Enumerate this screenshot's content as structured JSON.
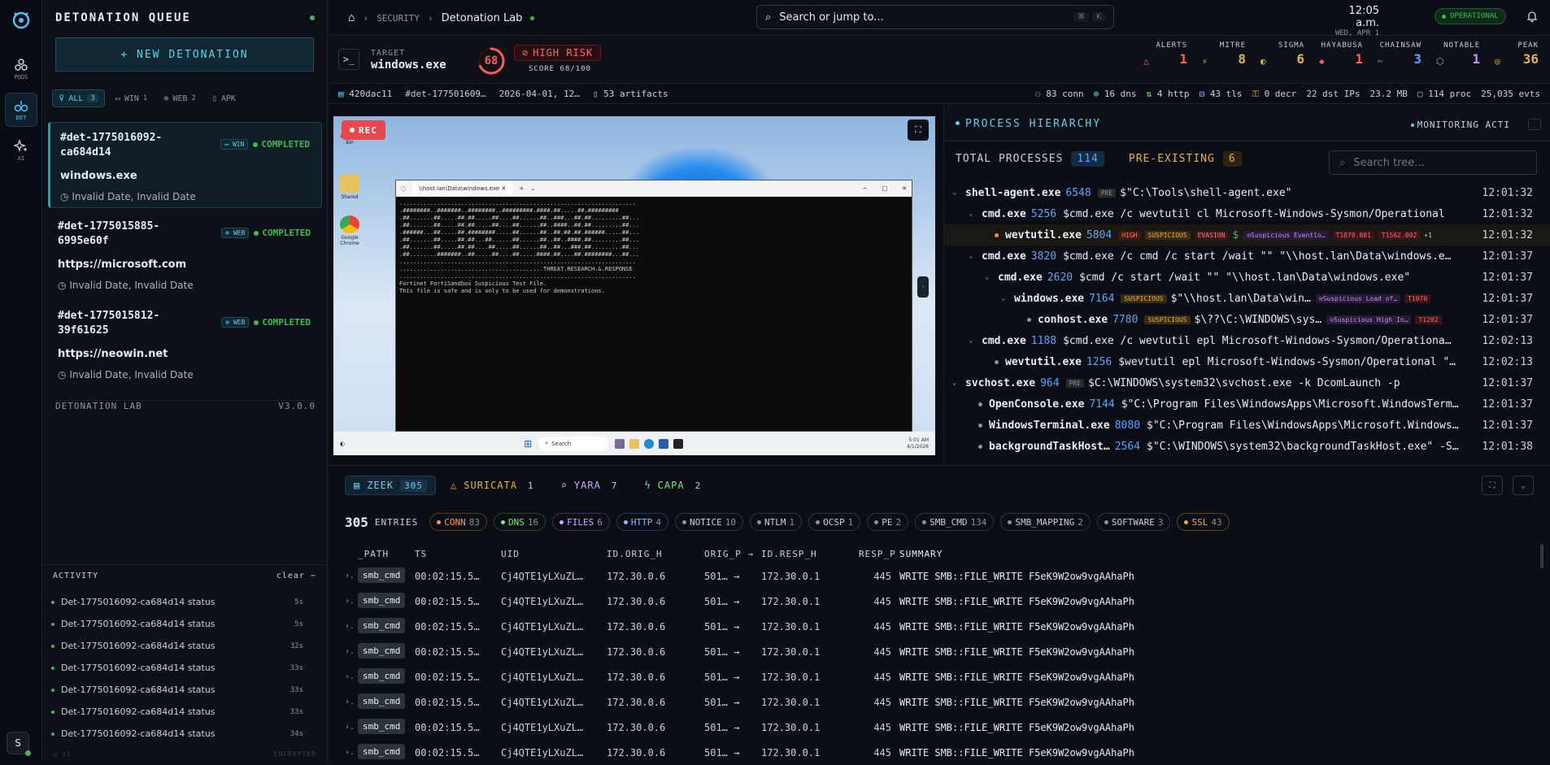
{
  "rail": {
    "items": [
      {
        "label": "PODS",
        "icon": "pods-icon"
      },
      {
        "label": "DET",
        "icon": "detonation-icon"
      },
      {
        "label": "AI",
        "icon": "ai-icon"
      }
    ],
    "avatar": "S"
  },
  "queue": {
    "title": "DETONATION QUEUE",
    "new_button": "+ NEW DETONATION",
    "filters": [
      {
        "label": "ALL",
        "count": "3"
      },
      {
        "label": "WIN",
        "count": "1"
      },
      {
        "label": "WEB",
        "count": "2"
      },
      {
        "label": "APK",
        "count": ""
      }
    ],
    "items": [
      {
        "id": "#det-1775016092-ca684d14",
        "os": "WIN",
        "status": "COMPLETED",
        "name": "windows.exe",
        "date": "Invalid Date, Invalid Date"
      },
      {
        "id": "#det-1775015885-6995e60f",
        "os": "WEB",
        "status": "COMPLETED",
        "name": "https://microsoft.com",
        "date": "Invalid Date, Invalid Date"
      },
      {
        "id": "#det-1775015812-39f61625",
        "os": "WEB",
        "status": "COMPLETED",
        "name": "https://neowin.net",
        "date": "Invalid Date, Invalid Date"
      }
    ],
    "footer_name": "DETONATION LAB",
    "footer_version": "V3.0.0",
    "activity": {
      "title": "ACTIVITY",
      "clear": "clear",
      "rows": [
        {
          "label": "Det-1775016092-ca684d14 status",
          "t": "5s"
        },
        {
          "label": "Det-1775016092-ca684d14 status",
          "t": "5s"
        },
        {
          "label": "Det-1775016092-ca684d14 status",
          "t": "32s"
        },
        {
          "label": "Det-1775016092-ca684d14 status",
          "t": "33s"
        },
        {
          "label": "Det-1775016092-ca684d14 status",
          "t": "33s"
        },
        {
          "label": "Det-1775016092-ca684d14 status",
          "t": "33s"
        },
        {
          "label": "Det-1775016092-ca684d14 status",
          "t": "34s"
        }
      ],
      "encrypted": "ENCRYPTED"
    }
  },
  "header": {
    "crumb1": "SECURITY",
    "crumb2": "Detonation Lab",
    "search_placeholder": "Search or jump to...",
    "kbd1": "⌘",
    "kbd2": "K",
    "time": "12:05 a.m.",
    "date": "WED, APR 1",
    "status": "OPERATIONAL"
  },
  "target": {
    "label": "TARGET",
    "name": "windows.exe",
    "score_num": "68",
    "risk": "HIGH RISK",
    "score": "SCORE 68/100",
    "score_fraction": 0.68,
    "stats": [
      {
        "label": "ALERTS",
        "value": "1",
        "color": "#ff5a5a",
        "icon": "△"
      },
      {
        "label": "MITRE",
        "value": "8",
        "color": "#e3b341",
        "icon": "⚡"
      },
      {
        "label": "SIGMA",
        "value": "6",
        "color": "#e3b341",
        "icon": "◐"
      },
      {
        "label": "HAYABUSA",
        "value": "1",
        "color": "#ff5a5a",
        "icon": "◆"
      },
      {
        "label": "CHAINSAW",
        "value": "3",
        "color": "#58a6ff",
        "icon": "✂"
      },
      {
        "label": "NOTABLE",
        "value": "1",
        "color": "#c792ea",
        "icon": "⬡"
      },
      {
        "label": "PEAK",
        "value": "36",
        "color": "#e3b341",
        "icon": "◎"
      }
    ]
  },
  "meta": {
    "hash": "420dac11",
    "det": "#det-177501609…",
    "date": "2026-04-01, 12…",
    "artifacts": "53 artifacts",
    "conn": "83 conn",
    "dns": "16 dns",
    "http": "4 http",
    "tls": "43 tls",
    "decr": "0 decr",
    "dst": "22 dst IPs",
    "size": "23.2 MB",
    "proc": "114 proc",
    "evts": "25,035 evts"
  },
  "video": {
    "rec": "REC",
    "term_title": "\\\\host.lan\\Data\\windows.exe",
    "term_lines": [
      ".....................................................................",
      ".########..#######..########..#########.####.##.....##.#########",
      ".##.......##.....##.##.....##....##......##..###...##.##.........##...",
      ".##.......##.....##.##.....##....##......##..####..##.##.........##...",
      ".######...##.....##.########.....##......##..##.##.##.######.....##...",
      ".##.......##.....##.##...##......##......##..##..####.##.........##...",
      ".##.......##.....##.##....##.....##......##..##...###.##.........##...",
      ".##........#######..##.....##....##.....####.##....##.########...##...",
      ".....................................................................",
      "..........................................THREAT.RESEARCH.&.RESPONSE",
      ".....................................................................",
      "Fortinet FortiSandbox Suspicious Test File.",
      "This file is safe and is only to be used for demonstrations."
    ],
    "desk_icons": [
      "Recycle Bin",
      "Shared",
      "Google Chrome"
    ],
    "taskbar_search": "Search",
    "tray_time": "5:01 AM",
    "tray_date": "4/1/2026"
  },
  "process": {
    "title": "PROCESS HIERARCHY",
    "monitoring": "MONITORING ACTI",
    "total_label": "TOTAL PROCESSES",
    "total": "114",
    "pre_label": "PRE-EXISTING",
    "pre": "6",
    "search_placeholder": "Search tree...",
    "rows": [
      {
        "name": "shell-agent.exe",
        "pid": "6548",
        "tags": [
          {
            "t": "PRE",
            "c": "pre"
          }
        ],
        "cmd": "\"C:\\Tools\\shell-agent.exe\"",
        "time": "12:01:32"
      },
      {
        "name": "cmd.exe",
        "pid": "5256",
        "tags": [],
        "cmd": "cmd.exe /c wevtutil cl Microsoft-Windows-Sysmon/Operational",
        "time": "12:01:32"
      },
      {
        "name": "wevtutil.exe",
        "pid": "5804",
        "tags": [
          {
            "t": "HIGH",
            "c": "high"
          },
          {
            "t": "SUSPICIOUS",
            "c": "susp"
          },
          {
            "t": "EVASION",
            "c": "evas"
          }
        ],
        "cmd": "",
        "sig": "Suspicious Eventlo…",
        "mitre": [
          "T1070.001",
          "T1562.002"
        ],
        "more": "+1",
        "time": "12:01:32"
      },
      {
        "name": "cmd.exe",
        "pid": "3820",
        "tags": [],
        "cmd": "cmd.exe /c cmd /c start /wait \"\" \"\\\\host.lan\\Data\\windows.e…",
        "time": "12:01:37"
      },
      {
        "name": "cmd.exe",
        "pid": "2620",
        "tags": [],
        "cmd": "cmd /c start /wait \"\" \"\\\\host.lan\\Data\\windows.exe\"",
        "time": "12:01:37"
      },
      {
        "name": "windows.exe",
        "pid": "7164",
        "tags": [
          {
            "t": "SUSPICIOUS",
            "c": "susp"
          }
        ],
        "cmd": "\"\\\\host.lan\\Data\\win…",
        "sig": "Suspicious Load of…",
        "mitre": [
          "T1070"
        ],
        "time": "12:01:37"
      },
      {
        "name": "conhost.exe",
        "pid": "7780",
        "tags": [
          {
            "t": "SUSPICIOUS",
            "c": "susp"
          }
        ],
        "cmd": "\\??\\C:\\WINDOWS\\sys…",
        "sig": "Suspicious High In…",
        "mitre": [
          "T1202"
        ],
        "time": "12:01:37"
      },
      {
        "name": "cmd.exe",
        "pid": "1188",
        "tags": [],
        "cmd": "cmd.exe /c wevtutil epl Microsoft-Windows-Sysmon/Operationa…",
        "time": "12:02:13"
      },
      {
        "name": "wevtutil.exe",
        "pid": "1256",
        "tags": [],
        "cmd": "wevtutil epl Microsoft-Windows-Sysmon/Operational \"…",
        "time": "12:02:13"
      },
      {
        "name": "svchost.exe",
        "pid": "964",
        "tags": [
          {
            "t": "PRE",
            "c": "pre"
          }
        ],
        "cmd": "C:\\WINDOWS\\system32\\svchost.exe -k DcomLaunch -p",
        "time": "12:01:37"
      },
      {
        "name": "OpenConsole.exe",
        "pid": "7144",
        "tags": [],
        "cmd": "\"C:\\Program Files\\WindowsApps\\Microsoft.WindowsTerm…",
        "time": "12:01:37"
      },
      {
        "name": "WindowsTerminal.exe",
        "pid": "8080",
        "tags": [],
        "cmd": "\"C:\\Program Files\\WindowsApps\\Microsoft.Windows…",
        "time": "12:01:37"
      },
      {
        "name": "backgroundTaskHost…",
        "pid": "2564",
        "tags": [],
        "cmd": "\"C:\\WINDOWS\\system32\\backgroundTaskHost.exe\" -S…",
        "time": "12:01:38"
      }
    ]
  },
  "logs": {
    "tabs": [
      {
        "label": "ZEEK",
        "count": "305"
      },
      {
        "label": "SURICATA",
        "count": "1"
      },
      {
        "label": "YARA",
        "count": "7"
      },
      {
        "label": "CAPA",
        "count": "2"
      }
    ],
    "entries": "305",
    "entries_label": "ENTRIES",
    "chips": [
      {
        "label": "CONN",
        "count": "83",
        "c": "conn"
      },
      {
        "label": "DNS",
        "count": "16",
        "c": "dns"
      },
      {
        "label": "FILES",
        "count": "6",
        "c": "files"
      },
      {
        "label": "HTTP",
        "count": "4",
        "c": "http"
      },
      {
        "label": "NOTICE",
        "count": "10",
        "c": ""
      },
      {
        "label": "NTLM",
        "count": "1",
        "c": ""
      },
      {
        "label": "OCSP",
        "count": "1",
        "c": ""
      },
      {
        "label": "PE",
        "count": "2",
        "c": ""
      },
      {
        "label": "SMB_CMD",
        "count": "134",
        "c": ""
      },
      {
        "label": "SMB_MAPPING",
        "count": "2",
        "c": ""
      },
      {
        "label": "SOFTWARE",
        "count": "3",
        "c": ""
      },
      {
        "label": "SSL",
        "count": "43",
        "c": "ssl"
      }
    ],
    "columns": [
      "_PATH",
      "TS",
      "UID",
      "ID.ORIG_H",
      "ORIG_P",
      "ID.RESP_H",
      "RESP_P",
      "SUMMARY"
    ],
    "rows": [
      {
        "path": "smb_cmd",
        "ts": "00:02:15.5…",
        "uid": "Cj4QTE1yLXuZL…",
        "oh": "172.30.0.6",
        "op": "501…",
        "rh": "172.30.0.1",
        "rp": "445",
        "sum": "WRITE SMB::FILE_WRITE F5eK9W2ow9vgAAhaPh"
      },
      {
        "path": "smb_cmd",
        "ts": "00:02:15.5…",
        "uid": "Cj4QTE1yLXuZL…",
        "oh": "172.30.0.6",
        "op": "501…",
        "rh": "172.30.0.1",
        "rp": "445",
        "sum": "WRITE SMB::FILE_WRITE F5eK9W2ow9vgAAhaPh"
      },
      {
        "path": "smb_cmd",
        "ts": "00:02:15.5…",
        "uid": "Cj4QTE1yLXuZL…",
        "oh": "172.30.0.6",
        "op": "501…",
        "rh": "172.30.0.1",
        "rp": "445",
        "sum": "WRITE SMB::FILE_WRITE F5eK9W2ow9vgAAhaPh"
      },
      {
        "path": "smb_cmd",
        "ts": "00:02:15.5…",
        "uid": "Cj4QTE1yLXuZL…",
        "oh": "172.30.0.6",
        "op": "501…",
        "rh": "172.30.0.1",
        "rp": "445",
        "sum": "WRITE SMB::FILE_WRITE F5eK9W2ow9vgAAhaPh"
      },
      {
        "path": "smb_cmd",
        "ts": "00:02:15.5…",
        "uid": "Cj4QTE1yLXuZL…",
        "oh": "172.30.0.6",
        "op": "501…",
        "rh": "172.30.0.1",
        "rp": "445",
        "sum": "WRITE SMB::FILE_WRITE F5eK9W2ow9vgAAhaPh"
      },
      {
        "path": "smb_cmd",
        "ts": "00:02:15.5…",
        "uid": "Cj4QTE1yLXuZL…",
        "oh": "172.30.0.6",
        "op": "501…",
        "rh": "172.30.0.1",
        "rp": "445",
        "sum": "WRITE SMB::FILE_WRITE F5eK9W2ow9vgAAhaPh"
      },
      {
        "path": "smb_cmd",
        "ts": "00:02:15.5…",
        "uid": "Cj4QTE1yLXuZL…",
        "oh": "172.30.0.6",
        "op": "501…",
        "rh": "172.30.0.1",
        "rp": "445",
        "sum": "WRITE SMB::FILE_WRITE F5eK9W2ow9vgAAhaPh"
      },
      {
        "path": "smb_cmd",
        "ts": "00:02:15.5…",
        "uid": "Cj4QTE1yLXuZL…",
        "oh": "172.30.0.6",
        "op": "501…",
        "rh": "172.30.0.1",
        "rp": "445",
        "sum": "WRITE SMB::FILE_WRITE F5eK9W2ow9vgAAhaPh"
      }
    ]
  }
}
